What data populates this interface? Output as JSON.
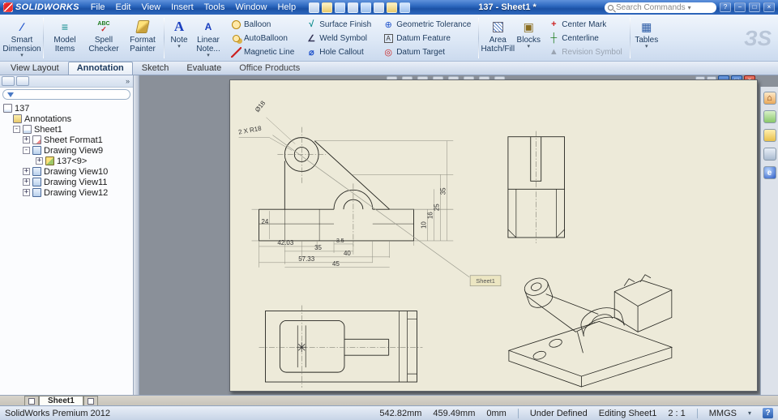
{
  "titlebar": {
    "app_name": "SOLIDWORKS",
    "menus": [
      "File",
      "Edit",
      "View",
      "Insert",
      "Tools",
      "Window",
      "Help"
    ],
    "doc_title": "137 - Sheet1 *",
    "search_placeholder": "Search Commands",
    "window": {
      "help": "?",
      "minimize": "−",
      "maximize": "□",
      "close": "×"
    }
  },
  "icons": {
    "caret": "▾",
    "collapse": "»",
    "smart_dimension": "∕",
    "model_items": "≡",
    "spell_abc": "ABC",
    "spell_check": "✓",
    "note": "A",
    "linear_note": "A",
    "surface_finish": "√",
    "weld_symbol": "∠",
    "hole_callout": "⌀",
    "geometric_tolerance": "⊕",
    "datum_feature": "A",
    "datum_target": "◎",
    "blocks": "▣",
    "center_mark": "+",
    "centerline": "┼",
    "revision_symbol": "▲",
    "tables": "▦",
    "home": "⌂",
    "appearances": "e"
  },
  "ribbon": {
    "items": {
      "smart_dimension": "Smart Dimension",
      "model_items": "Model Items",
      "spell_checker": "Spell Checker",
      "format_painter": "Format Painter",
      "note": "Note",
      "linear_note": "Linear Note...",
      "balloon": "Balloon",
      "autoballoon": "AutoBalloon",
      "magnetic_line": "Magnetic Line",
      "surface_finish": "Surface Finish",
      "weld_symbol": "Weld Symbol",
      "hole_callout": "Hole Callout",
      "geometric_tolerance": "Geometric Tolerance",
      "datum_feature": "Datum Feature",
      "datum_target": "Datum Target",
      "area_hatch": "Area Hatch/Fill",
      "blocks": "Blocks",
      "center_mark": "Center Mark",
      "centerline": "Centerline",
      "revision_symbol": "Revision Symbol",
      "tables": "Tables"
    },
    "watermark": "ЗS"
  },
  "command_tabs": {
    "items": [
      "View Layout",
      "Annotation",
      "Sketch",
      "Evaluate",
      "Office Products"
    ],
    "active": "Annotation"
  },
  "feature_tree": {
    "root": "137",
    "items": [
      {
        "label": "Annotations"
      },
      {
        "label": "Sheet1"
      },
      {
        "label": "Sheet Format1"
      },
      {
        "label": "Drawing View9"
      },
      {
        "label": "137<9>"
      },
      {
        "label": "Drawing View10"
      },
      {
        "label": "Drawing View11"
      },
      {
        "label": "Drawing View12"
      }
    ]
  },
  "drawing": {
    "note_box": "Sheet1",
    "dims": {
      "diameter": "Ø18",
      "radius": "2 X R18",
      "height": "24",
      "b1": "42.03",
      "b2": "35",
      "b3": "40",
      "b4": "3.5",
      "b5": "57.33",
      "b6": "45",
      "r1": "10",
      "r2": "16",
      "r3": "25",
      "r4": "35"
    }
  },
  "sheet_tabs": {
    "active": "Sheet1"
  },
  "statusbar": {
    "app": "SolidWorks Premium 2012",
    "coord_x": "542.82mm",
    "coord_y": "459.49mm",
    "coord_z": "0mm",
    "define_state": "Under Defined",
    "editing": "Editing Sheet1",
    "scale": "2 : 1",
    "units": "MMGS"
  }
}
